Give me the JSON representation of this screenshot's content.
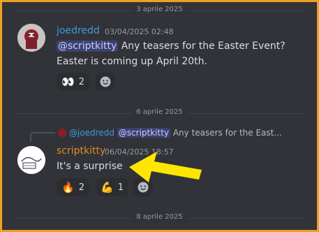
{
  "dividers": [
    "3 aprile 2025",
    "6 aprile 2025",
    "8 aprile 2025"
  ],
  "message1": {
    "author": "joedredd",
    "timestamp": "03/04/2025 02:48",
    "mention": "@scriptkitty",
    "line1": " Any teasers for the Easter Event?",
    "line2": "Easter is coming up April 20th.",
    "reactions": [
      {
        "emoji": "👀",
        "count": "2"
      }
    ]
  },
  "message2": {
    "reply": {
      "author": "@joedredd",
      "mention": "@scriptkitty",
      "text": " Any teasers for the East..."
    },
    "author": "scriptkitty",
    "timestamp": "06/04/2025 18:57",
    "text": "It's a surprise",
    "reactions": [
      {
        "emoji": "🔥",
        "count": "2"
      },
      {
        "emoji": "💪",
        "count": "1"
      }
    ]
  },
  "colors": {
    "frame": "#f0a020",
    "background": "#313338",
    "author1": "#3d9be0",
    "author2": "#e08a2a",
    "arrow": "#ffe600",
    "mention_bg": "#3c4270"
  },
  "icons": [
    "add-reaction-icon",
    "arrow-annotation"
  ]
}
